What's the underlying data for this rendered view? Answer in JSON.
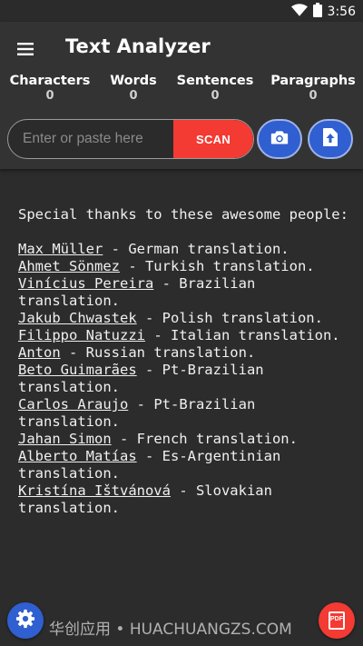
{
  "status_bar": {
    "time": "3:56",
    "icons": [
      "wifi-icon",
      "battery-icon"
    ]
  },
  "app_bar": {
    "title": "Text Analyzer",
    "menu_icon": "hamburger-menu-icon"
  },
  "stats": [
    {
      "label": "Characters",
      "value": "0"
    },
    {
      "label": "Words",
      "value": "0"
    },
    {
      "label": "Sentences",
      "value": "0"
    },
    {
      "label": "Paragraphs",
      "value": "0"
    }
  ],
  "input": {
    "placeholder": "Enter or paste here",
    "value": ""
  },
  "buttons": {
    "scan_label": "SCAN",
    "camera_icon": "camera-icon",
    "upload_icon": "file-upload-icon",
    "settings_icon": "gear-icon",
    "pdf_icon": "pdf-icon",
    "pdf_label": "PDF"
  },
  "content": {
    "intro": "Special thanks to these awesome people:",
    "credits": [
      {
        "name": "Max Müller",
        "role": " - German translation."
      },
      {
        "name": "Ahmet Sönmez",
        "role": " - Turkish translation."
      },
      {
        "name": "Vinícius Pereira",
        "role": " - Brazilian translation."
      },
      {
        "name": "Jakub Chwastek",
        "role": " - Polish translation."
      },
      {
        "name": "Filippo Natuzzi",
        "role": " - Italian translation."
      },
      {
        "name": "Anton",
        "role": " - Russian translation."
      },
      {
        "name": "Beto Guimarães",
        "role": " - Pt-Brazilian translation."
      },
      {
        "name": "Carlos Araujo",
        "role": " - Pt-Brazilian translation."
      },
      {
        "name": "Jahan Simon",
        "role": " - French translation."
      },
      {
        "name": "Alberto Matías",
        "role": " - Es-Argentinian translation."
      },
      {
        "name": "Kristína Ištvánová",
        "role": " - Slovakian translation."
      }
    ]
  },
  "watermark": "华创应用 • HUACHUANGZS.COM",
  "colors": {
    "accent_red": "#f33a33",
    "accent_blue": "#2f5fd0",
    "background": "#2c2c2c",
    "app_bar": "#333333"
  }
}
